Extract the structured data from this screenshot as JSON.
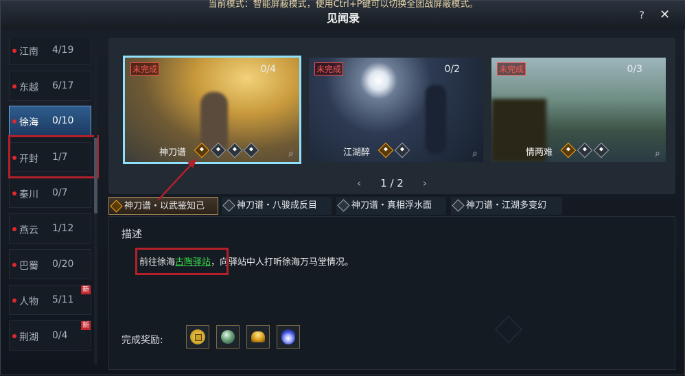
{
  "window": {
    "notice": "当前模式：智能屏蔽模式，使用Ctrl+P键可以切换全团战屏蔽模式。",
    "title": "见闻录",
    "help_label": "?",
    "close_label": "✕"
  },
  "sidebar": {
    "items": [
      {
        "name": "江南",
        "count": "4/19"
      },
      {
        "name": "东越",
        "count": "6/17"
      },
      {
        "name": "徐海",
        "count": "0/10",
        "active": true
      },
      {
        "name": "开封",
        "count": "1/7"
      },
      {
        "name": "秦川",
        "count": "0/7"
      },
      {
        "name": "燕云",
        "count": "1/12"
      },
      {
        "name": "巴蜀",
        "count": "0/20"
      },
      {
        "name": "人物",
        "count": "5/11",
        "tag": "新"
      },
      {
        "name": "荆湖",
        "count": "0/4",
        "tag": "新"
      }
    ]
  },
  "gallery": {
    "cards": [
      {
        "status": "未完成",
        "progress": "0/4",
        "name": "神刀谱",
        "badge_icons": [
          "gold-diamond-icon",
          "grey-diamond-icon",
          "grey-diamond-icon",
          "grey-diamond-icon"
        ]
      },
      {
        "status": "未完成",
        "progress": "0/2",
        "name": "江湖醉",
        "badge_icons": [
          "gold-diamond-icon",
          "grey-diamond-icon"
        ]
      },
      {
        "status": "未完成",
        "progress": "0/3",
        "name": "情两难",
        "badge_icons": [
          "gold-diamond-icon",
          "grey-diamond-icon",
          "grey-diamond-icon"
        ]
      }
    ],
    "page": "1 / 2",
    "prev_icon": "‹",
    "next_icon": "›",
    "magnify_icon": "⌕"
  },
  "subtabs": [
    {
      "label": "神刀谱・以武鉴知己",
      "active": true
    },
    {
      "label": "神刀谱・八骏成反目"
    },
    {
      "label": "神刀谱・真相浮水面"
    },
    {
      "label": "神刀谱・江湖多变幻"
    }
  ],
  "description": {
    "heading": "描述",
    "text_before": "前往徐海",
    "link": "古陶驿站",
    "text_after": "，向驿站中人打听徐海万马堂情况。",
    "reward_label": "完成奖励:",
    "rewards": [
      "coin-icon",
      "jade-orb-icon",
      "gold-ingot-icon",
      "blue-flame-icon"
    ]
  },
  "colors": {
    "highlight_red": "#b3202a",
    "link_green": "#3ad84b",
    "selected_blue": "#8fe1ff",
    "status_red": "#ff5757"
  }
}
